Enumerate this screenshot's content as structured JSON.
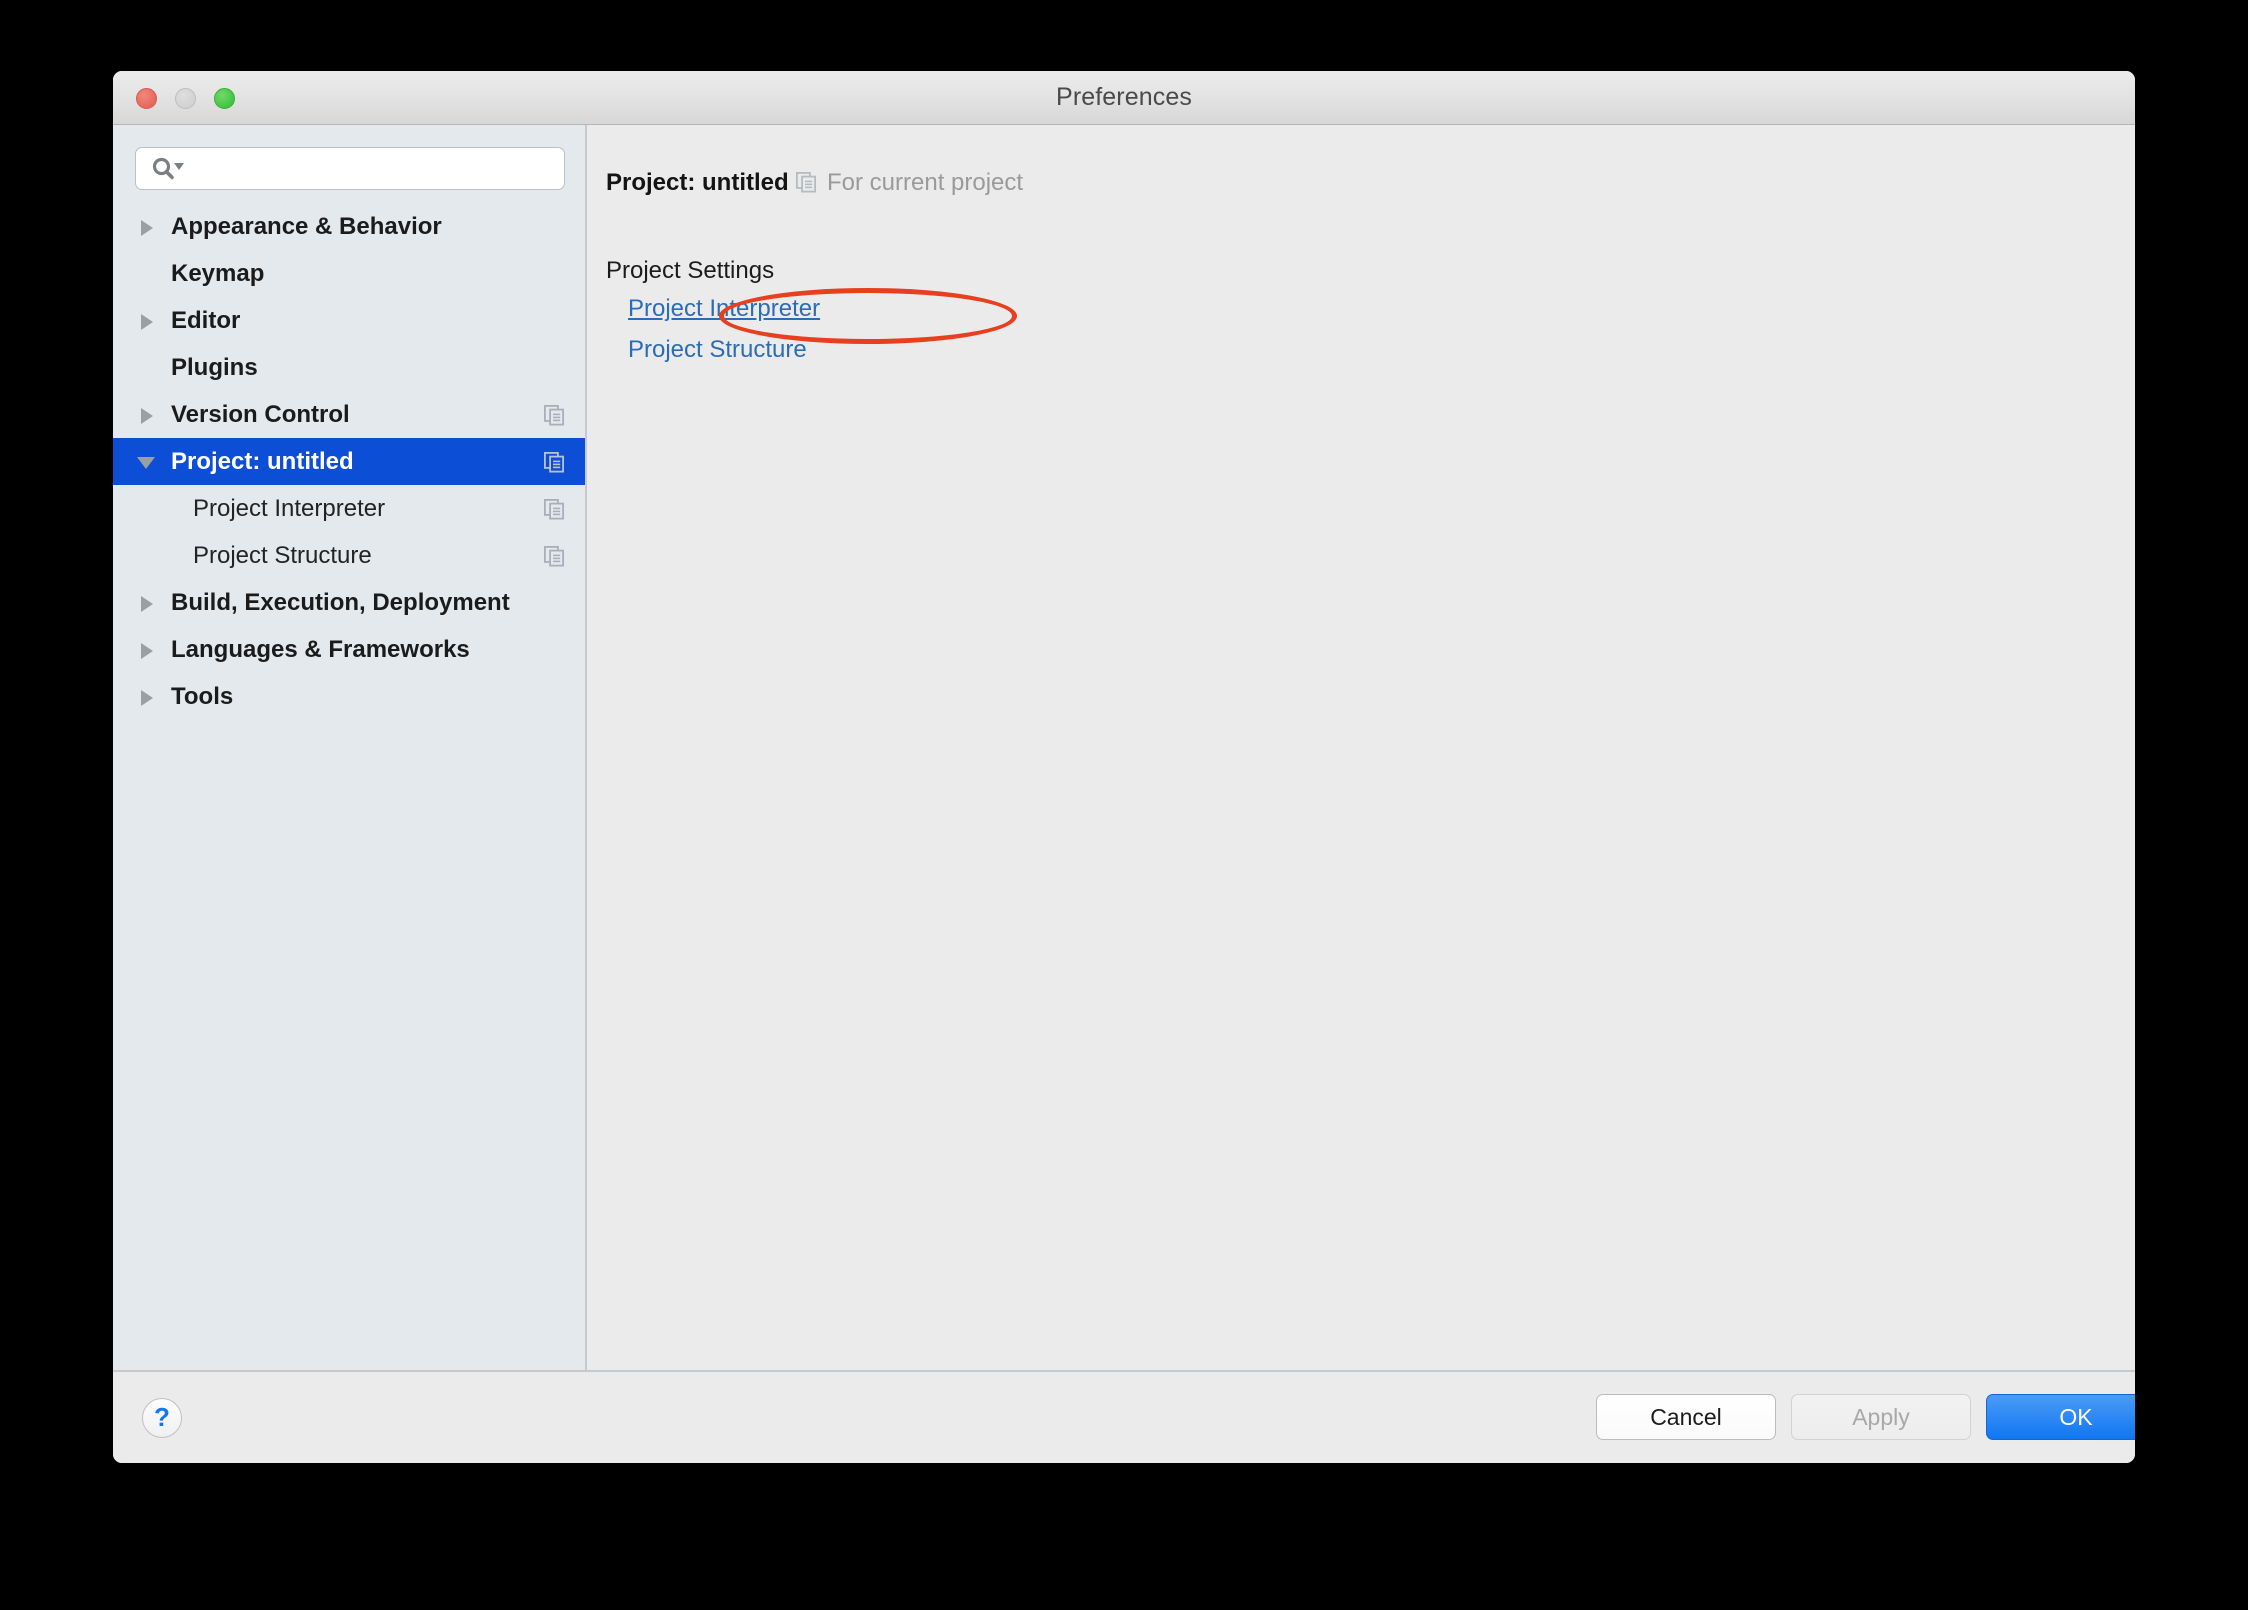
{
  "window": {
    "title": "Preferences",
    "traffic_lights": [
      {
        "name": "close",
        "color": "#e8665a"
      },
      {
        "name": "minimize",
        "color": "#d2d2d2"
      },
      {
        "name": "maximize",
        "color": "#41c441"
      }
    ]
  },
  "search": {
    "value": "",
    "placeholder": "",
    "icon": "search-icon"
  },
  "sidebar": {
    "items": [
      {
        "label": "Appearance & Behavior",
        "level": 0,
        "twisty": "right",
        "selected": false,
        "copy_icon": false
      },
      {
        "label": "Keymap",
        "level": 0,
        "twisty": "none",
        "selected": false,
        "copy_icon": false
      },
      {
        "label": "Editor",
        "level": 0,
        "twisty": "right",
        "selected": false,
        "copy_icon": false
      },
      {
        "label": "Plugins",
        "level": 0,
        "twisty": "none",
        "selected": false,
        "copy_icon": false
      },
      {
        "label": "Version Control",
        "level": 0,
        "twisty": "right",
        "selected": false,
        "copy_icon": true
      },
      {
        "label": "Project: untitled",
        "level": 0,
        "twisty": "down",
        "selected": true,
        "copy_icon": true
      },
      {
        "label": "Project Interpreter",
        "level": 1,
        "twisty": "none",
        "selected": false,
        "copy_icon": true
      },
      {
        "label": "Project Structure",
        "level": 1,
        "twisty": "none",
        "selected": false,
        "copy_icon": true
      },
      {
        "label": "Build, Execution, Deployment",
        "level": 0,
        "twisty": "right",
        "selected": false,
        "copy_icon": false
      },
      {
        "label": "Languages & Frameworks",
        "level": 0,
        "twisty": "right",
        "selected": false,
        "copy_icon": false
      },
      {
        "label": "Tools",
        "level": 0,
        "twisty": "right",
        "selected": false,
        "copy_icon": false
      }
    ],
    "selection_color": "#0c4fd6"
  },
  "content": {
    "title": "Project: untitled",
    "scope_note": "For current project",
    "scope_icon": "copy-icon",
    "section_title": "Project Settings",
    "links": [
      {
        "label": "Project Interpreter",
        "underlined": true
      },
      {
        "label": "Project Structure",
        "underlined": false
      }
    ],
    "annotation": {
      "shape": "ellipse",
      "color": "#e8401f",
      "target": "Project Interpreter"
    }
  },
  "footer": {
    "help_label": "?",
    "cancel_label": "Cancel",
    "apply_label": "Apply",
    "apply_enabled": false,
    "ok_label": "OK",
    "ok_color": "#1176f2"
  }
}
